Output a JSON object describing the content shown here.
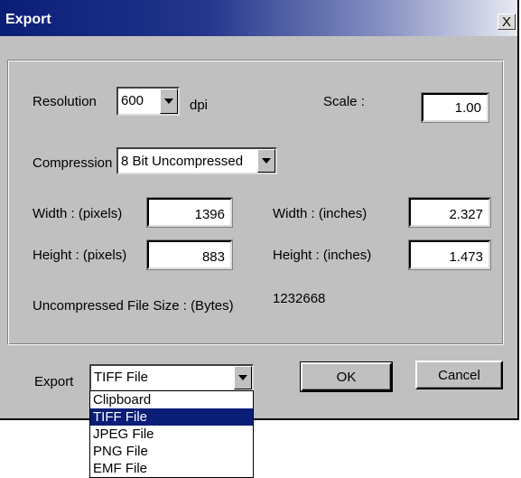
{
  "window": {
    "title": "Export",
    "close_label": "X"
  },
  "settings": {
    "resolution": {
      "label": "Resolution",
      "value": "600",
      "unit": "dpi"
    },
    "scale": {
      "label": "Scale :",
      "value": "1.00"
    },
    "compression": {
      "label": "Compression",
      "value": "8 Bit Uncompressed"
    },
    "width_pixels": {
      "label": "Width :  (pixels)",
      "value": "1396"
    },
    "width_inches": {
      "label": "Width : (inches)",
      "value": "2.327"
    },
    "height_pixels": {
      "label": "Height : (pixels)",
      "value": "883"
    },
    "height_inches": {
      "label": "Height : (inches)",
      "value": "1.473"
    },
    "file_size": {
      "label": "Uncompressed File Size : (Bytes)",
      "value": "1232668"
    }
  },
  "export": {
    "label": "Export",
    "selected": "TIFF File",
    "options": [
      "Clipboard",
      "TIFF File",
      "JPEG File",
      "PNG File",
      "EMF File"
    ]
  },
  "buttons": {
    "ok": "OK",
    "cancel": "Cancel"
  }
}
